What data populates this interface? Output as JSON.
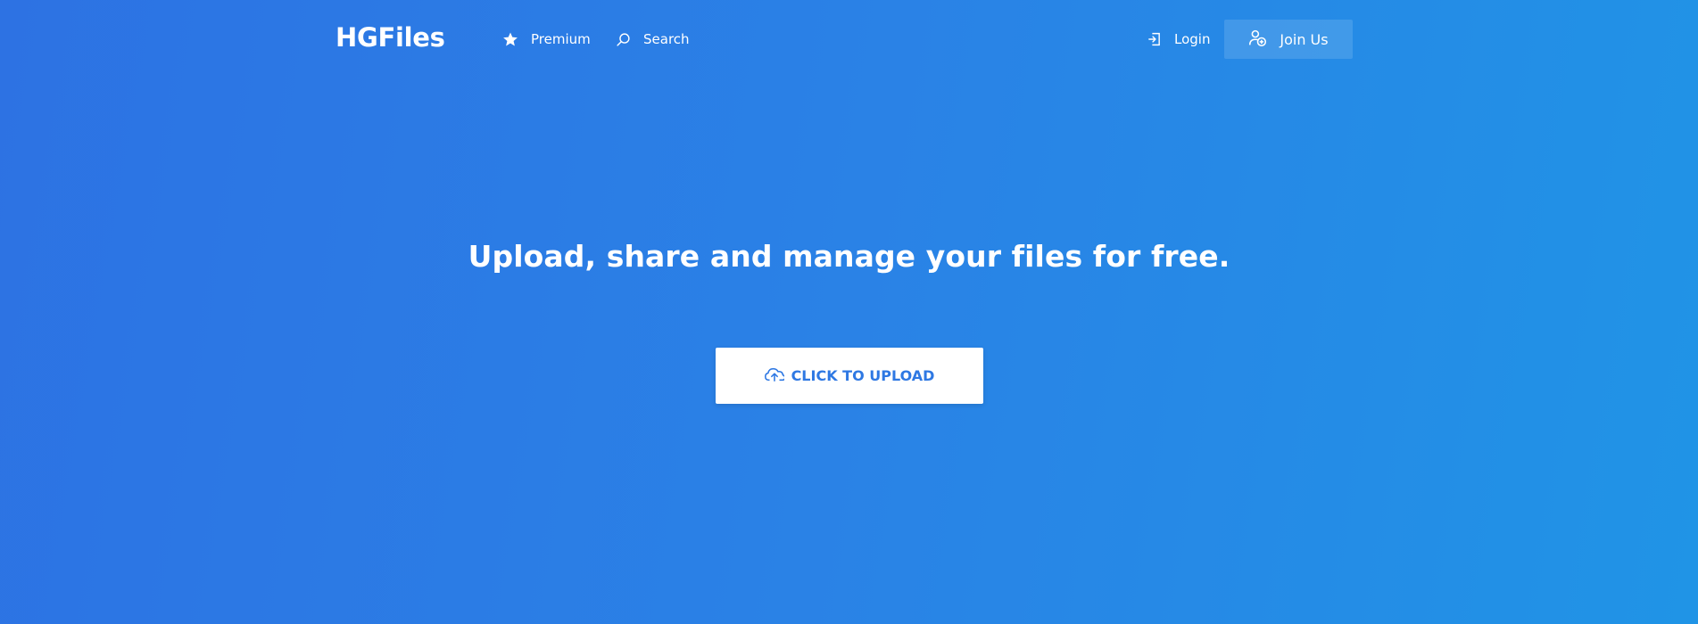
{
  "brand": {
    "logo_text": "HGFiles"
  },
  "nav": {
    "premium_label": "Premium",
    "search_label": "Search",
    "login_label": "Login",
    "join_label": "Join Us",
    "icons": {
      "premium": "star-icon",
      "search": "search-icon",
      "login": "login-icon",
      "join": "add-user-icon"
    }
  },
  "hero": {
    "headline": "Upload, share and manage your files for free.",
    "upload_button_label": "CLICK TO UPLOAD",
    "upload_icon": "cloud-upload-icon"
  },
  "colors": {
    "background_start": "#2d72e3",
    "background_end": "#2094e6",
    "text": "#ffffff",
    "button_text": "#2e78e3",
    "button_background": "#ffffff"
  }
}
